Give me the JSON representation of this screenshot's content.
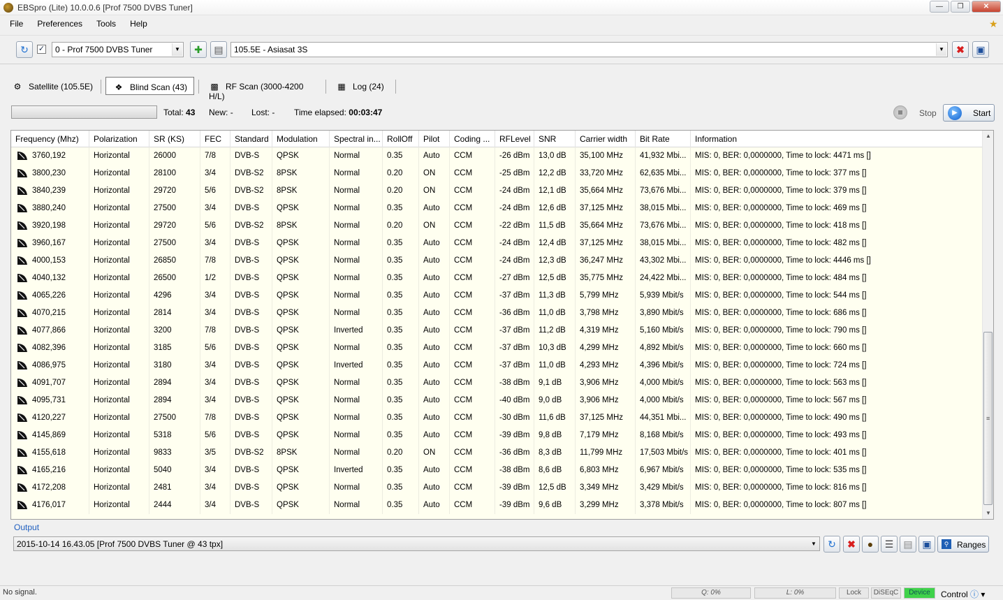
{
  "window": {
    "title": "EBSpro (Lite) 10.0.0.6 [Prof 7500 DVBS Tuner]"
  },
  "menu": [
    "File",
    "Preferences",
    "Tools",
    "Help"
  ],
  "toolbar": {
    "tuner_enabled": true,
    "tuner": "0 - Prof 7500 DVBS Tuner",
    "satellite": "105.5E - Asiasat 3S"
  },
  "tabs": [
    {
      "label": "Satellite (105.5E)",
      "icon": "satellite-dish-icon"
    },
    {
      "label": "Blind Scan (43)",
      "icon": "scan-icon"
    },
    {
      "label": "RF Scan (3000-4200 H/L)",
      "icon": "spectrum-icon"
    },
    {
      "label": "Log (24)",
      "icon": "document-icon"
    }
  ],
  "active_tab": 1,
  "status": {
    "total_label": "Total:",
    "total": "43",
    "new_label": "New:",
    "new": "-",
    "lost_label": "Lost:",
    "lost": "-",
    "elapsed_label": "Time elapsed:",
    "elapsed": "00:03:47",
    "stop_label": "Stop",
    "start_label": "Start"
  },
  "columns": [
    "Frequency (Mhz)",
    "Polarization",
    "SR (KS)",
    "FEC",
    "Standard",
    "Modulation",
    "Spectral in...",
    "RollOff",
    "Pilot",
    "Coding ...",
    "RFLevel",
    "SNR",
    "Carrier width",
    "Bit Rate",
    "Information"
  ],
  "rows": [
    [
      "3760,192",
      "Horizontal",
      "26000",
      "7/8",
      "DVB-S",
      "QPSK",
      "Normal",
      "0.35",
      "Auto",
      "CCM",
      "-26 dBm",
      "13,0 dB",
      "35,100 MHz",
      "41,932 Mbi...",
      "MIS: 0, BER: 0,0000000, Time to lock: 4471 ms []"
    ],
    [
      "3800,230",
      "Horizontal",
      "28100",
      "3/4",
      "DVB-S2",
      "8PSK",
      "Normal",
      "0.20",
      "ON",
      "CCM",
      "-25 dBm",
      "12,2 dB",
      "33,720 MHz",
      "62,635 Mbi...",
      "MIS: 0, BER: 0,0000000, Time to lock: 377 ms []"
    ],
    [
      "3840,239",
      "Horizontal",
      "29720",
      "5/6",
      "DVB-S2",
      "8PSK",
      "Normal",
      "0.20",
      "ON",
      "CCM",
      "-24 dBm",
      "12,1 dB",
      "35,664 MHz",
      "73,676 Mbi...",
      "MIS: 0, BER: 0,0000000, Time to lock: 379 ms []"
    ],
    [
      "3880,240",
      "Horizontal",
      "27500",
      "3/4",
      "DVB-S",
      "QPSK",
      "Normal",
      "0.35",
      "Auto",
      "CCM",
      "-24 dBm",
      "12,6 dB",
      "37,125 MHz",
      "38,015 Mbi...",
      "MIS: 0, BER: 0,0000000, Time to lock: 469 ms []"
    ],
    [
      "3920,198",
      "Horizontal",
      "29720",
      "5/6",
      "DVB-S2",
      "8PSK",
      "Normal",
      "0.20",
      "ON",
      "CCM",
      "-22 dBm",
      "11,5 dB",
      "35,664 MHz",
      "73,676 Mbi...",
      "MIS: 0, BER: 0,0000000, Time to lock: 418 ms []"
    ],
    [
      "3960,167",
      "Horizontal",
      "27500",
      "3/4",
      "DVB-S",
      "QPSK",
      "Normal",
      "0.35",
      "Auto",
      "CCM",
      "-24 dBm",
      "12,4 dB",
      "37,125 MHz",
      "38,015 Mbi...",
      "MIS: 0, BER: 0,0000000, Time to lock: 482 ms []"
    ],
    [
      "4000,153",
      "Horizontal",
      "26850",
      "7/8",
      "DVB-S",
      "QPSK",
      "Normal",
      "0.35",
      "Auto",
      "CCM",
      "-24 dBm",
      "12,3 dB",
      "36,247 MHz",
      "43,302 Mbi...",
      "MIS: 0, BER: 0,0000000, Time to lock: 4446 ms []"
    ],
    [
      "4040,132",
      "Horizontal",
      "26500",
      "1/2",
      "DVB-S",
      "QPSK",
      "Normal",
      "0.35",
      "Auto",
      "CCM",
      "-27 dBm",
      "12,5 dB",
      "35,775 MHz",
      "24,422 Mbi...",
      "MIS: 0, BER: 0,0000000, Time to lock: 484 ms []"
    ],
    [
      "4065,226",
      "Horizontal",
      "4296",
      "3/4",
      "DVB-S",
      "QPSK",
      "Normal",
      "0.35",
      "Auto",
      "CCM",
      "-37 dBm",
      "11,3 dB",
      "5,799 MHz",
      "5,939 Mbit/s",
      "MIS: 0, BER: 0,0000000, Time to lock: 544 ms []"
    ],
    [
      "4070,215",
      "Horizontal",
      "2814",
      "3/4",
      "DVB-S",
      "QPSK",
      "Normal",
      "0.35",
      "Auto",
      "CCM",
      "-36 dBm",
      "11,0 dB",
      "3,798 MHz",
      "3,890 Mbit/s",
      "MIS: 0, BER: 0,0000000, Time to lock: 686 ms []"
    ],
    [
      "4077,866",
      "Horizontal",
      "3200",
      "7/8",
      "DVB-S",
      "QPSK",
      "Inverted",
      "0.35",
      "Auto",
      "CCM",
      "-37 dBm",
      "11,2 dB",
      "4,319 MHz",
      "5,160 Mbit/s",
      "MIS: 0, BER: 0,0000000, Time to lock: 790 ms []"
    ],
    [
      "4082,396",
      "Horizontal",
      "3185",
      "5/6",
      "DVB-S",
      "QPSK",
      "Normal",
      "0.35",
      "Auto",
      "CCM",
      "-37 dBm",
      "10,3 dB",
      "4,299 MHz",
      "4,892 Mbit/s",
      "MIS: 0, BER: 0,0000000, Time to lock: 660 ms []"
    ],
    [
      "4086,975",
      "Horizontal",
      "3180",
      "3/4",
      "DVB-S",
      "QPSK",
      "Inverted",
      "0.35",
      "Auto",
      "CCM",
      "-37 dBm",
      "11,0 dB",
      "4,293 MHz",
      "4,396 Mbit/s",
      "MIS: 0, BER: 0,0000000, Time to lock: 724 ms []"
    ],
    [
      "4091,707",
      "Horizontal",
      "2894",
      "3/4",
      "DVB-S",
      "QPSK",
      "Normal",
      "0.35",
      "Auto",
      "CCM",
      "-38 dBm",
      "9,1 dB",
      "3,906 MHz",
      "4,000 Mbit/s",
      "MIS: 0, BER: 0,0000000, Time to lock: 563 ms []"
    ],
    [
      "4095,731",
      "Horizontal",
      "2894",
      "3/4",
      "DVB-S",
      "QPSK",
      "Normal",
      "0.35",
      "Auto",
      "CCM",
      "-40 dBm",
      "9,0 dB",
      "3,906 MHz",
      "4,000 Mbit/s",
      "MIS: 0, BER: 0,0000000, Time to lock: 567 ms []"
    ],
    [
      "4120,227",
      "Horizontal",
      "27500",
      "7/8",
      "DVB-S",
      "QPSK",
      "Normal",
      "0.35",
      "Auto",
      "CCM",
      "-30 dBm",
      "11,6 dB",
      "37,125 MHz",
      "44,351 Mbi...",
      "MIS: 0, BER: 0,0000000, Time to lock: 490 ms []"
    ],
    [
      "4145,869",
      "Horizontal",
      "5318",
      "5/6",
      "DVB-S",
      "QPSK",
      "Normal",
      "0.35",
      "Auto",
      "CCM",
      "-39 dBm",
      "9,8 dB",
      "7,179 MHz",
      "8,168 Mbit/s",
      "MIS: 0, BER: 0,0000000, Time to lock: 493 ms []"
    ],
    [
      "4155,618",
      "Horizontal",
      "9833",
      "3/5",
      "DVB-S2",
      "8PSK",
      "Normal",
      "0.20",
      "ON",
      "CCM",
      "-36 dBm",
      "8,3 dB",
      "11,799 MHz",
      "17,503 Mbit/s",
      "MIS: 0, BER: 0,0000000, Time to lock: 401 ms []"
    ],
    [
      "4165,216",
      "Horizontal",
      "5040",
      "3/4",
      "DVB-S",
      "QPSK",
      "Inverted",
      "0.35",
      "Auto",
      "CCM",
      "-38 dBm",
      "8,6 dB",
      "6,803 MHz",
      "6,967 Mbit/s",
      "MIS: 0, BER: 0,0000000, Time to lock: 535 ms []"
    ],
    [
      "4172,208",
      "Horizontal",
      "2481",
      "3/4",
      "DVB-S",
      "QPSK",
      "Normal",
      "0.35",
      "Auto",
      "CCM",
      "-39 dBm",
      "12,5 dB",
      "3,349 MHz",
      "3,429 Mbit/s",
      "MIS: 0, BER: 0,0000000, Time to lock: 816 ms []"
    ],
    [
      "4176,017",
      "Horizontal",
      "2444",
      "3/4",
      "DVB-S",
      "QPSK",
      "Normal",
      "0.35",
      "Auto",
      "CCM",
      "-39 dBm",
      "9,6 dB",
      "3,299 MHz",
      "3,378 Mbit/s",
      "MIS: 0, BER: 0,0000000, Time to lock: 807 ms []"
    ]
  ],
  "output": {
    "label": "Output",
    "selected": "2015-10-14 16.43.05 [Prof 7500 DVBS Tuner @ 43 tpx]",
    "ranges_label": "Ranges"
  },
  "statusbar": {
    "message": "No signal.",
    "quality": "Q: 0%",
    "level": "L: 0%",
    "lock": "Lock",
    "diseqc": "DiSEqC",
    "device": "Device",
    "control": "Control"
  },
  "colors": {
    "row_bg": "#fffff0",
    "device_ok": "#3fd24a",
    "link_blue": "#1f5fbf"
  }
}
